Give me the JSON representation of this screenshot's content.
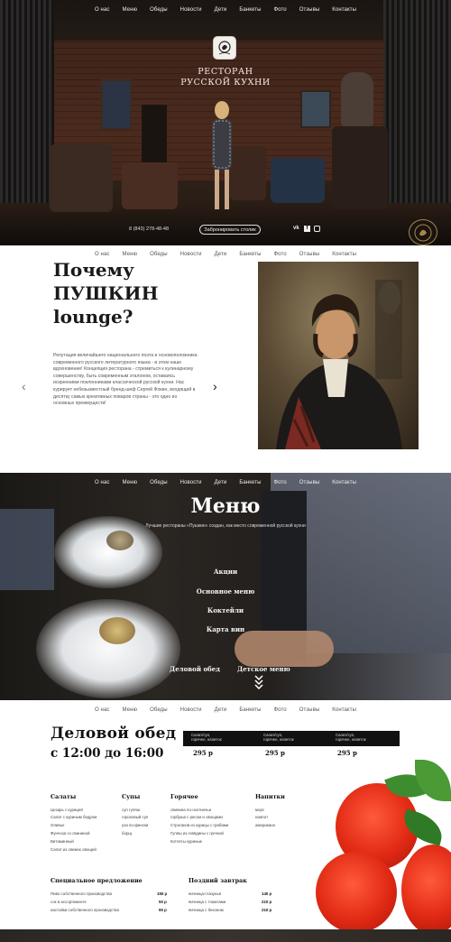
{
  "nav": {
    "items": [
      "О нас",
      "Меню",
      "Обеды",
      "Новости",
      "Дети",
      "Банкеты",
      "Фото",
      "Отзывы",
      "Контакты"
    ]
  },
  "hero": {
    "title_line1": "РЕСТОРАН",
    "title_line2": "РУССКОЙ КУХНИ",
    "phone": "8 (843) 278-48-48",
    "book_button": "Забронировать столик",
    "social": [
      "vk-icon",
      "facebook-icon",
      "instagram-icon"
    ]
  },
  "about": {
    "title_line1": "Почему",
    "title_line2": "ПУШКИН",
    "title_line3": "lounge?",
    "text": "Репутация величайшего национального поэта и основоположника современного русского литературного языка - в этом наше вдохновение! Концепция ресторана - стремиться к кулинарному совершенству, быть современным эталоном, оставаясь искренними поклонниками классической русской кухни. Нас курирует небезызвестный бренд-шеф Сергей Фокин, входящий в десятку самых креативных поваров страны - это одно из основных преимуществ!",
    "prev": "‹",
    "next": "›"
  },
  "menu": {
    "title": "Меню",
    "subtitle": "Лучшие рестораны «Пушкин» создан, как место современной русской кухни",
    "items": [
      "Акции",
      "Основное меню",
      "Коктейли",
      "Карта вин"
    ],
    "bottom_left": "Деловой обед",
    "bottom_right": "Детское меню"
  },
  "lunch": {
    "title": "Деловой обед",
    "time": "с 12:00 до 16:00",
    "price_cols": [
      {
        "line1": "Салат/суп,",
        "line2": "горячее, напиток",
        "price": "295 р"
      },
      {
        "line1": "Салат/суп,",
        "line2": "горячее, напиток",
        "price": "295 р"
      },
      {
        "line1": "Салат/суп,",
        "line2": "горячее, напиток",
        "price": "295 р"
      }
    ],
    "categories": [
      {
        "name": "Салаты",
        "items": [
          "Цезарь с курицей",
          "Салат с куриным бедром",
          "Оливье",
          "Фунчоза со свининой",
          "Витаминный",
          "Салат из свежих овощей"
        ]
      },
      {
        "name": "Супы",
        "items": [
          "суп гуляш",
          "гороховый суп",
          "уха по-фински",
          "борщ"
        ]
      },
      {
        "name": "Горячее",
        "items": [
          "свинина по-охотничьи",
          "горбуша с рисом и овощами",
          "Строганов из курицы с грибами",
          "Гуляш из говядины с гречкой",
          "Котлеты куриные"
        ]
      },
      {
        "name": "Напитки",
        "items": [
          "морс",
          "компот",
          "американо"
        ]
      }
    ],
    "special": {
      "name": "Специальное предложение",
      "items": [
        {
          "label": "Пиво собственного производства",
          "price": "150 р"
        },
        {
          "label": "сок в ассортименте",
          "price": "50 р"
        },
        {
          "label": "настойки собственного производства",
          "price": "90 р"
        }
      ]
    },
    "breakfast": {
      "name": "Поздний завтрак",
      "items": [
        {
          "label": "яичница-глазунья",
          "price": "140 р"
        },
        {
          "label": "яичница с томатами",
          "price": "210 р"
        },
        {
          "label": "яичница с беконом",
          "price": "210 р"
        }
      ]
    }
  },
  "colors": {
    "dark": "#111111",
    "accent_gold": "#a8874a",
    "tomato": "#e12a14"
  }
}
